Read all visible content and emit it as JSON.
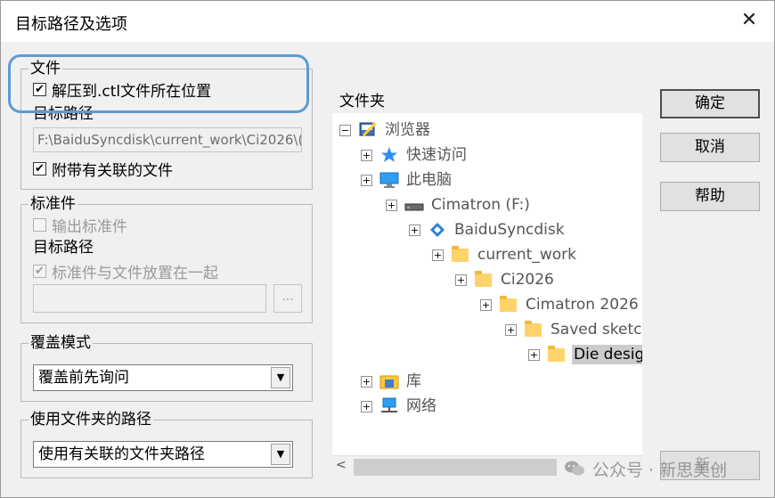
{
  "window": {
    "title": "目标路径及选项",
    "close_glyph": "✕"
  },
  "file_group": {
    "legend": "文件",
    "extract_label": "解压到.ctl文件所在位置",
    "extract_checked": true,
    "target_path_label": "目标路径",
    "target_path_value": "F:\\BaiduSyncdisk\\current_work\\Ci2026\\(",
    "attach_label": "附带有关联的文件",
    "attach_checked": true
  },
  "standard_group": {
    "legend": "标准件",
    "output_label": "输出标准件",
    "output_checked": false,
    "target_path_label": "目标路径",
    "together_label": "标准件与文件放置在一起",
    "together_checked": true,
    "path_value": "",
    "browse_label": "..."
  },
  "overwrite_group": {
    "legend": "覆盖模式",
    "selected": "覆盖前先询问"
  },
  "folder_path_group": {
    "legend": "使用文件夹的路径",
    "selected": "使用有关联的文件夹路径"
  },
  "folder_tree": {
    "header": "文件夹",
    "nodes": [
      {
        "label": "浏览器",
        "expander": "−",
        "icon": "browser-icon"
      },
      {
        "label": "快速访问",
        "expander": "+",
        "icon": "quick-access-icon"
      },
      {
        "label": "此电脑",
        "expander": "+",
        "icon": "computer-icon"
      },
      {
        "label": "Cimatron (F:)",
        "expander": "+",
        "icon": "drive-icon"
      },
      {
        "label": "BaiduSyncdisk",
        "expander": "+",
        "icon": "baidu-sync-icon"
      },
      {
        "label": "current_work",
        "expander": "+",
        "icon": "folder-icon"
      },
      {
        "label": "Ci2026",
        "expander": "+",
        "icon": "folder-icon"
      },
      {
        "label": "Cimatron 2026",
        "expander": "+",
        "icon": "folder-icon"
      },
      {
        "label": "Saved sketc",
        "expander": "+",
        "icon": "folder-icon"
      },
      {
        "label": "Die desig",
        "expander": "+",
        "icon": "folder-icon",
        "selected": true
      },
      {
        "label": "库",
        "expander": "+",
        "icon": "library-icon"
      },
      {
        "label": "网络",
        "expander": "+",
        "icon": "network-icon"
      }
    ]
  },
  "buttons": {
    "ok": "确定",
    "cancel": "取消",
    "help": "帮助",
    "new": "新..."
  },
  "watermark": {
    "text": "公众号 · 新思美创"
  },
  "colors": {
    "highlight": "#5b9bd5",
    "selection": "#cccccc",
    "folder": "#ffd36b"
  }
}
